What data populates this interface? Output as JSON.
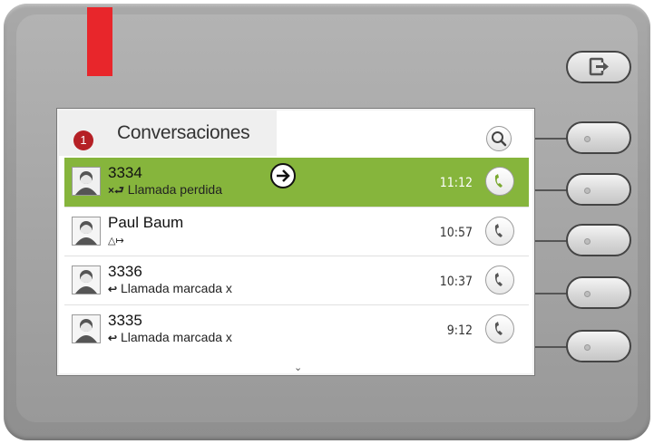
{
  "screen": {
    "badge_count": "1",
    "title": "Conversaciones"
  },
  "rows": [
    {
      "name": "3334",
      "status": "Llamada perdida",
      "status_icon": "missed-call-icon",
      "time": "11:12",
      "active": true
    },
    {
      "name": "Paul Baum",
      "status": "",
      "status_icon": "forwarded-call-icon",
      "time": "10:57",
      "active": false
    },
    {
      "name": "3336",
      "status": "Llamada marcada x",
      "status_icon": "dialed-call-icon",
      "time": "10:37",
      "active": false
    },
    {
      "name": "3335",
      "status": "Llamada marcada x",
      "status_icon": "dialed-call-icon",
      "time": "9:12",
      "active": false
    }
  ],
  "colors": {
    "active_row": "#86b53c",
    "badge": "#b52025",
    "led": "#e8262b"
  }
}
